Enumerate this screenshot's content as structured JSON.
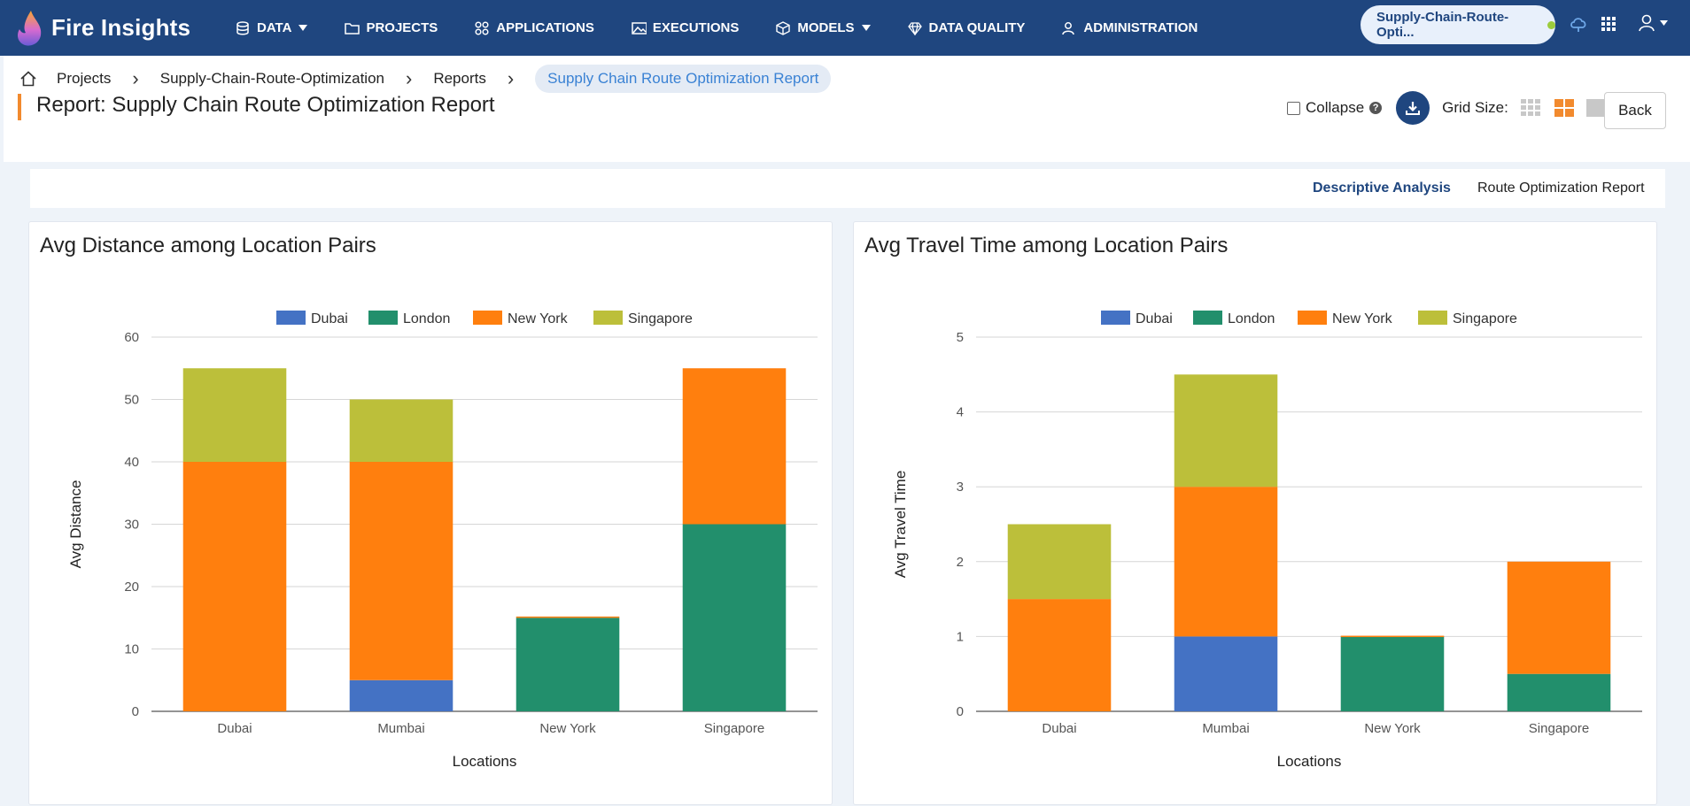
{
  "app": {
    "brand": "Fire Insights",
    "nav": [
      {
        "label": "DATA",
        "icon": "database-icon",
        "caret": true
      },
      {
        "label": "PROJECTS",
        "icon": "folder-icon",
        "caret": false
      },
      {
        "label": "APPLICATIONS",
        "icon": "apps-icon",
        "caret": false
      },
      {
        "label": "EXECUTIONS",
        "icon": "image-icon",
        "caret": false
      },
      {
        "label": "MODELS",
        "icon": "cube-icon",
        "caret": true
      },
      {
        "label": "DATA QUALITY",
        "icon": "diamond-icon",
        "caret": false
      },
      {
        "label": "ADMINISTRATION",
        "icon": "user-gear-icon",
        "caret": false
      }
    ],
    "project_pill": "Supply-Chain-Route-Opti...",
    "status_color": "#9ccc3c"
  },
  "breadcrumb": {
    "home_icon": "home-icon",
    "items": [
      "Projects",
      "Supply-Chain-Route-Optimization",
      "Reports"
    ],
    "active": "Supply Chain Route Optimization Report"
  },
  "header": {
    "title": "Report: Supply Chain Route Optimization Report",
    "collapse_label": "Collapse",
    "help": "?",
    "grid_size_label": "Grid Size:",
    "back_label": "Back"
  },
  "tabs": [
    {
      "label": "Descriptive Analysis",
      "active": true
    },
    {
      "label": "Route Optimization Report",
      "active": false
    }
  ],
  "colors": {
    "Dubai": "#4472c4",
    "London": "#228f6c",
    "New York": "#ff7f0e",
    "Singapore": "#bcbf3a",
    "nav_bg": "#1f467f",
    "accent": "#f28a2e"
  },
  "chart_data": [
    {
      "type": "bar",
      "stacked": true,
      "title": "Avg Distance among Location Pairs",
      "xlabel": "Locations",
      "ylabel": "Avg Distance",
      "categories": [
        "Dubai",
        "Mumbai",
        "New York",
        "Singapore"
      ],
      "ylim": [
        0,
        60
      ],
      "yticks": [
        0,
        10,
        20,
        30,
        40,
        50,
        60
      ],
      "legend_position": "top",
      "grid": true,
      "series": [
        {
          "name": "Dubai",
          "values": [
            0,
            5,
            0,
            0
          ]
        },
        {
          "name": "London",
          "values": [
            0,
            0,
            15,
            30
          ]
        },
        {
          "name": "New York",
          "values": [
            40,
            35,
            0.2,
            25
          ]
        },
        {
          "name": "Singapore",
          "values": [
            15,
            10,
            0,
            0
          ]
        }
      ]
    },
    {
      "type": "bar",
      "stacked": true,
      "title": "Avg Travel Time among Location Pairs",
      "xlabel": "Locations",
      "ylabel": "Avg Travel Time",
      "categories": [
        "Dubai",
        "Mumbai",
        "New York",
        "Singapore"
      ],
      "ylim": [
        0,
        5
      ],
      "yticks": [
        0,
        1,
        2,
        3,
        4,
        5
      ],
      "legend_position": "top",
      "grid": true,
      "series": [
        {
          "name": "Dubai",
          "values": [
            0,
            1,
            0,
            0
          ]
        },
        {
          "name": "London",
          "values": [
            0,
            0,
            1,
            0.5
          ]
        },
        {
          "name": "New York",
          "values": [
            1.5,
            2,
            0.01,
            1.5
          ]
        },
        {
          "name": "Singapore",
          "values": [
            1,
            1.5,
            0,
            0
          ]
        }
      ]
    }
  ]
}
